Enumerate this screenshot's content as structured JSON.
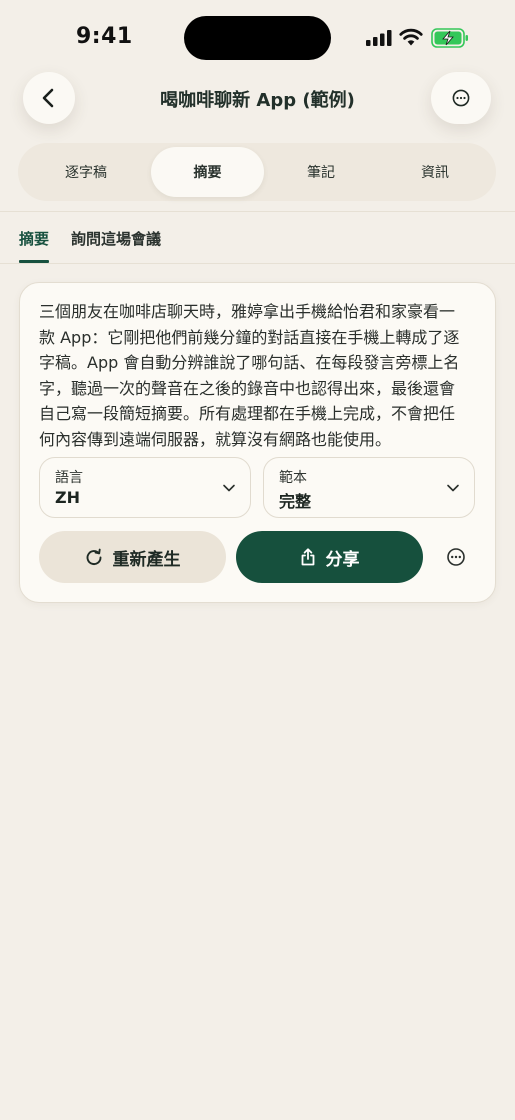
{
  "status_bar": {
    "time": "9:41"
  },
  "header": {
    "title": "喝咖啡聊新 App (範例)"
  },
  "tabs": [
    {
      "label": "逐字稿",
      "active": false
    },
    {
      "label": "摘要",
      "active": true
    },
    {
      "label": "筆記",
      "active": false
    },
    {
      "label": "資訊",
      "active": false
    }
  ],
  "subtabs": [
    {
      "label": "摘要",
      "active": true
    },
    {
      "label": "詢問這場會議",
      "active": false
    }
  ],
  "summary": {
    "lines": [
      "三個朋友在咖啡店聊天時，雅婷拿出手機給怡君和家豪看一",
      "款 App：它剛把他們前幾分鐘的對話直接在手機上轉成了逐",
      "字稿。App 會自動分辨誰說了哪句話、在每段發言旁標上名",
      "字，聽過一次的聲音在之後的錄音中也認得出來，最後還會",
      "自己寫一段簡短摘要。所有處理都在手機上完成，不會把任",
      "何內容傳到遠端伺服器，就算沒有網路也能使用。"
    ],
    "language": {
      "label": "語言",
      "value": "ZH"
    },
    "template": {
      "label": "範本",
      "value": "完整"
    },
    "regenerate_label": "重新產生",
    "share_label": "分享"
  },
  "colors": {
    "accent": "#16503d",
    "background": "#f3efe8",
    "card": "#fcfaf5",
    "battery": "#34c759"
  },
  "icons": {
    "back": "chevron-left-icon",
    "more": "ellipsis-circle-icon",
    "regenerate": "refresh-icon",
    "share": "share-icon",
    "chevron": "chevron-down-icon"
  }
}
